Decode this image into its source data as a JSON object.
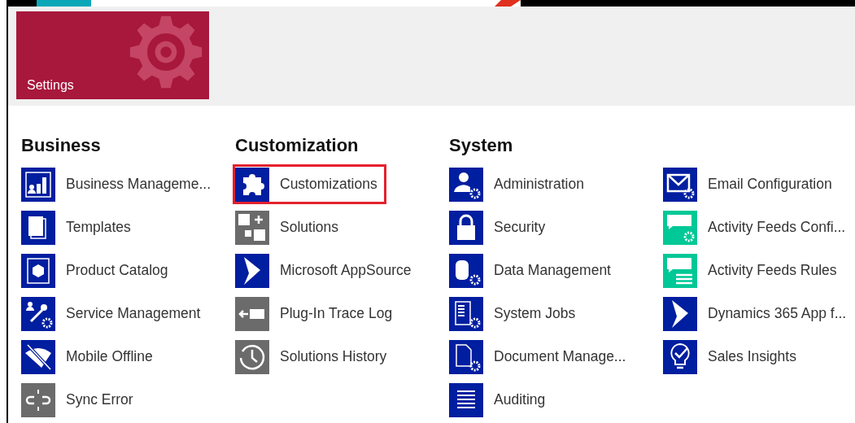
{
  "tile": {
    "label": "Settings"
  },
  "groups": [
    {
      "title": "Business",
      "items": [
        {
          "label": "Business Manageme...",
          "kind": "chart",
          "color": "#001ea0",
          "highlighted": false
        },
        {
          "label": "Templates",
          "kind": "pages",
          "color": "#001ea0",
          "highlighted": false
        },
        {
          "label": "Product Catalog",
          "kind": "box",
          "color": "#001ea0",
          "highlighted": false
        },
        {
          "label": "Service Management",
          "kind": "tools",
          "color": "#001ea0",
          "highlighted": false
        },
        {
          "label": "Mobile Offline",
          "kind": "offline",
          "color": "#001ea0",
          "highlighted": false
        },
        {
          "label": "Sync Error",
          "kind": "unlink",
          "color": "#6b6b6b",
          "highlighted": false
        }
      ]
    },
    {
      "title": "Customization",
      "items": [
        {
          "label": "Customizations",
          "kind": "puzzle",
          "color": "#001ea0",
          "highlighted": true
        },
        {
          "label": "Solutions",
          "kind": "squares",
          "color": "#6b6b6b",
          "highlighted": false
        },
        {
          "label": "Microsoft AppSource",
          "kind": "arrowhead",
          "color": "#001ea0",
          "highlighted": false
        },
        {
          "label": "Plug-In Trace Log",
          "kind": "plug",
          "color": "#6b6b6b",
          "highlighted": false
        },
        {
          "label": "Solutions History",
          "kind": "history",
          "color": "#6b6b6b",
          "highlighted": false
        }
      ]
    },
    {
      "title": "System",
      "items": [
        {
          "label": "Administration",
          "kind": "usergear",
          "color": "#001ea0",
          "highlighted": false
        },
        {
          "label": "Security",
          "kind": "lock",
          "color": "#001ea0",
          "highlighted": false
        },
        {
          "label": "Data Management",
          "kind": "dbgear",
          "color": "#001ea0",
          "highlighted": false
        },
        {
          "label": "System Jobs",
          "kind": "listgear",
          "color": "#001ea0",
          "highlighted": false
        },
        {
          "label": "Document Manage...",
          "kind": "docgear",
          "color": "#001ea0",
          "highlighted": false
        },
        {
          "label": "Auditing",
          "kind": "list",
          "color": "#001ea0",
          "highlighted": false
        }
      ]
    },
    {
      "items": [
        {
          "label": "Email Configuration",
          "kind": "mailgear",
          "color": "#001ea0",
          "highlighted": false
        },
        {
          "label": "Activity Feeds Confi...",
          "kind": "chatgear",
          "color": "#00c896",
          "highlighted": false
        },
        {
          "label": "Activity Feeds Rules",
          "kind": "chatlist",
          "color": "#00c896",
          "highlighted": false
        },
        {
          "label": "Dynamics 365 App f...",
          "kind": "arrowhead",
          "color": "#001ea0",
          "highlighted": false
        },
        {
          "label": "Sales Insights",
          "kind": "bulb",
          "color": "#001ea0",
          "highlighted": false
        }
      ]
    }
  ]
}
